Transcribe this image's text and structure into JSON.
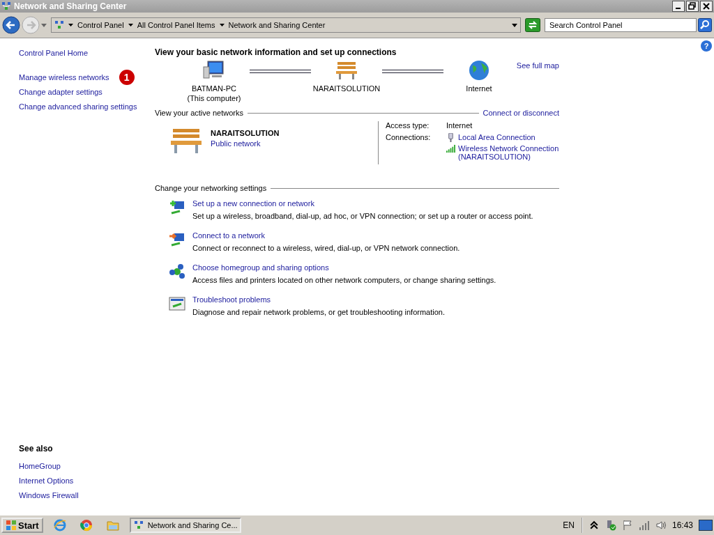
{
  "window": {
    "title": "Network and Sharing Center"
  },
  "nav": {
    "breadcrumbs": [
      "Control Panel",
      "All Control Panel Items",
      "Network and Sharing Center"
    ],
    "search": {
      "placeholder": "Search Control Panel"
    }
  },
  "sidebar": {
    "links": [
      {
        "label": "Control Panel Home",
        "kind": "home"
      },
      {
        "label": "Manage wireless networks",
        "kind": "task",
        "badge": "1"
      },
      {
        "label": "Change adapter settings",
        "kind": "task"
      },
      {
        "label": "Change advanced sharing settings",
        "kind": "task"
      }
    ],
    "see_also": {
      "heading": "See also",
      "links": [
        "HomeGroup",
        "Internet Options",
        "Windows Firewall"
      ]
    }
  },
  "main": {
    "heading": "View your basic network information and set up connections",
    "map": {
      "nodes": [
        {
          "kind": "computer",
          "name": "BATMAN-PC",
          "subtitle": "(This computer)"
        },
        {
          "kind": "network",
          "name": "NARAITSOLUTION"
        },
        {
          "kind": "internet",
          "name": "Internet"
        }
      ],
      "see_full_map": "See full map"
    },
    "active": {
      "title": "View your active networks",
      "link": "Connect or disconnect",
      "network": {
        "name": "NARAITSOLUTION",
        "type": "Public network",
        "access_label": "Access type:",
        "access": "Internet",
        "connections_label": "Connections:",
        "connections": [
          {
            "kind": "wired",
            "label": "Local Area Connection"
          },
          {
            "kind": "wireless",
            "label": "Wireless Network Connection",
            "detail": "(NARAITSOLUTION)"
          }
        ]
      }
    },
    "settings": {
      "title": "Change your networking settings",
      "tasks": [
        {
          "kind": "new",
          "title": "Set up a new connection or network",
          "description": "Set up a wireless, broadband, dial-up, ad hoc, or VPN connection; or set up a router or access point."
        },
        {
          "kind": "connect",
          "title": "Connect to a network",
          "description": "Connect or reconnect to a wireless, wired, dial-up, or VPN network connection."
        },
        {
          "kind": "homegroup",
          "title": "Choose homegroup and sharing options",
          "description": "Access files and printers located on other network computers, or change sharing settings."
        },
        {
          "kind": "troubleshoot",
          "title": "Troubleshoot problems",
          "description": "Diagnose and repair network problems, or get troubleshooting information."
        }
      ]
    }
  },
  "help": "?",
  "taskbar": {
    "start": "Start",
    "window": "Network and Sharing Ce...",
    "language": "EN",
    "clock": "16:43"
  }
}
